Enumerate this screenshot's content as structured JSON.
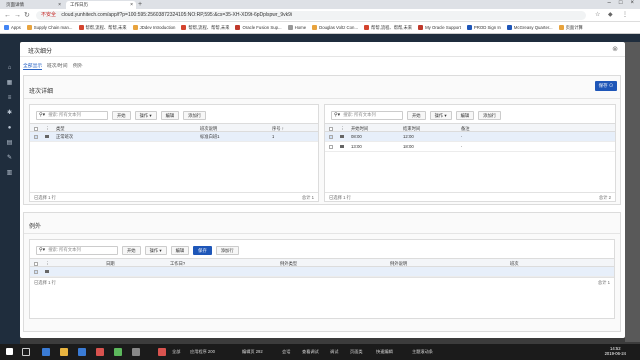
{
  "browser": {
    "tabs": [
      {
        "label": "页面详情"
      },
      {
        "label": "工作日历"
      }
    ],
    "url_security": "不安全",
    "url": "cloud.yunhitech.com/app/f?p=100:595:25603872324105:NO:RP,595:&cs=35-XH-XD9t-6pDplspwr_9vk9i",
    "bookmarks": [
      "Apps",
      "Supply Chain man...",
      "帮帮,流程、帮帮,未来",
      "JDdev Introduction",
      "帮帮,流程、帮帮,未来",
      "Oracle Fusion Sup...",
      "Home",
      "Douglas Voltz Con...",
      "帮帮,流程、帮帮,未来",
      "My Oracle Support",
      "PROD Sign In",
      "McGreasy Quarter...",
      "页面计算"
    ]
  },
  "modal": {
    "title": "班次细分",
    "tabs": [
      "全部显示",
      "班次/时间",
      "例外"
    ],
    "section_title": "班次详细",
    "save_label": "保存",
    "left_grid": {
      "search_placeholder": "搜索: 所有文本列",
      "go_label": "开始",
      "actions_label": "操作",
      "edit_label": "编辑",
      "add_row_label": "添加行",
      "columns": [
        "",
        "",
        "类型",
        "班次说明",
        "序号"
      ],
      "rows": [
        {
          "type": "正常班次",
          "desc": "标准白班1",
          "seq": "1"
        }
      ],
      "footer_left": "已选择 1 行",
      "footer_right": "总计 1"
    },
    "right_grid": {
      "search_placeholder": "搜索: 所有文本列",
      "go_label": "开始",
      "actions_label": "操作",
      "edit_label": "编辑",
      "add_row_label": "添加行",
      "columns": [
        "",
        "",
        "开始时间",
        "结束时间",
        "备注"
      ],
      "rows": [
        {
          "start": "08:00",
          "end": "12:00",
          "note": "-"
        },
        {
          "start": "13:00",
          "end": "18:00",
          "note": "-"
        }
      ],
      "footer_left": "已选择 1 行",
      "footer_right": "总计 2"
    },
    "exceptions": {
      "title": "例外",
      "search_placeholder": "搜索: 所有文本列",
      "go_label": "开始",
      "actions_label": "操作",
      "edit_label": "编辑",
      "save_label": "保存",
      "add_row_label": "添加行",
      "columns": [
        "",
        "",
        "日期",
        "工作日?",
        "例外类型",
        "例外说明",
        "班次"
      ],
      "footer_left": "已选择 1 行",
      "footer_right": "总计 1"
    }
  },
  "taskbar": {
    "items": [
      "全部",
      "应用程序 200",
      "编辑页 292",
      "会话",
      "查看调试",
      "调试",
      "页面类",
      "快速编辑",
      "主题滚动条"
    ],
    "time": "14:52",
    "date": "2019-06-24"
  },
  "colors": {
    "accent": "#1e56b8",
    "app_sidebar": "#1f2d3d"
  }
}
